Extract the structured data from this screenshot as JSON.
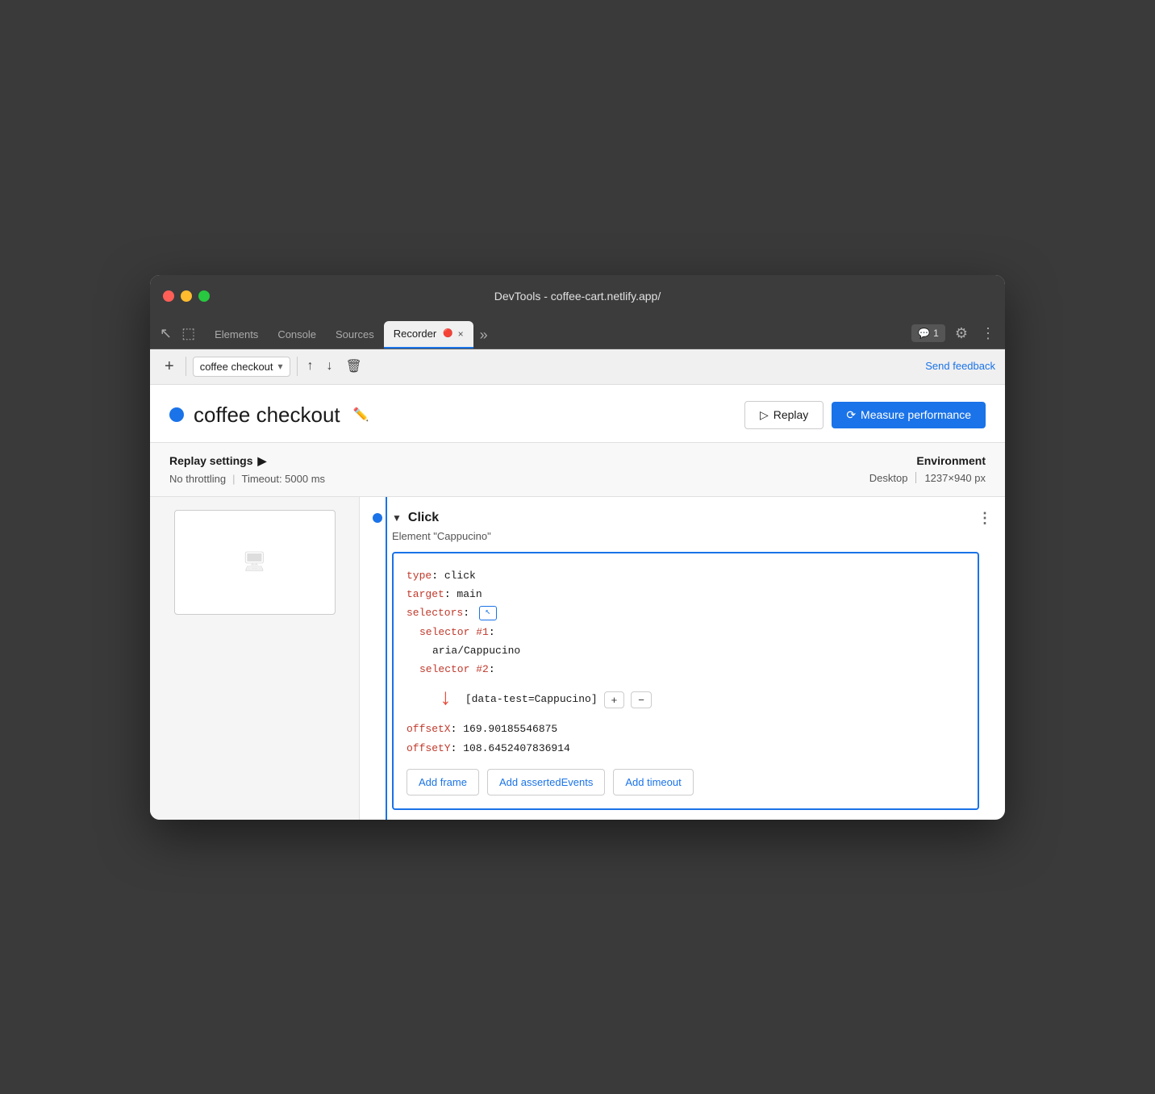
{
  "titlebar": {
    "title": "DevTools - coffee-cart.netlify.app/"
  },
  "tabs": [
    {
      "label": "Elements",
      "active": false
    },
    {
      "label": "Console",
      "active": false
    },
    {
      "label": "Sources",
      "active": false
    },
    {
      "label": "Recorder",
      "active": true
    },
    {
      "label": "×",
      "active": false
    }
  ],
  "tabbar": {
    "more_label": "»",
    "badge_label": "1",
    "settings_icon": "⚙",
    "more_icon": "⋮"
  },
  "toolbar": {
    "add_label": "+",
    "recording_name": "coffee checkout",
    "chevron": "▾",
    "export_icon": "↑",
    "import_icon": "↓",
    "delete_icon": "🗑",
    "send_feedback": "Send feedback"
  },
  "recording_header": {
    "name": "coffee checkout",
    "replay_label": "Replay",
    "measure_label": "Measure performance"
  },
  "replay_settings": {
    "title": "Replay settings",
    "chevron": "▶",
    "no_throttling": "No throttling",
    "timeout": "Timeout: 5000 ms",
    "environment_title": "Environment",
    "desktop": "Desktop",
    "resolution": "1237×940 px"
  },
  "step": {
    "type": "Click",
    "element": "Element \"Cappucino\"",
    "collapse_icon": "▼",
    "menu_icon": "⋮",
    "code": {
      "type_key": "type",
      "type_val": "click",
      "target_key": "target",
      "target_val": "main",
      "selectors_key": "selectors",
      "selector1_key": "selector #1",
      "selector1_val": "aria/Cappucino",
      "selector2_key": "selector #2",
      "selector2_val": "[data-test=Cappucino]",
      "offsetX_key": "offsetX",
      "offsetX_val": "169.90185546875",
      "offsetY_key": "offsetY",
      "offsetY_val": "108.6452407836914"
    },
    "add_frame": "Add frame",
    "add_asserted_events": "Add assertedEvents",
    "add_timeout": "Add timeout"
  }
}
